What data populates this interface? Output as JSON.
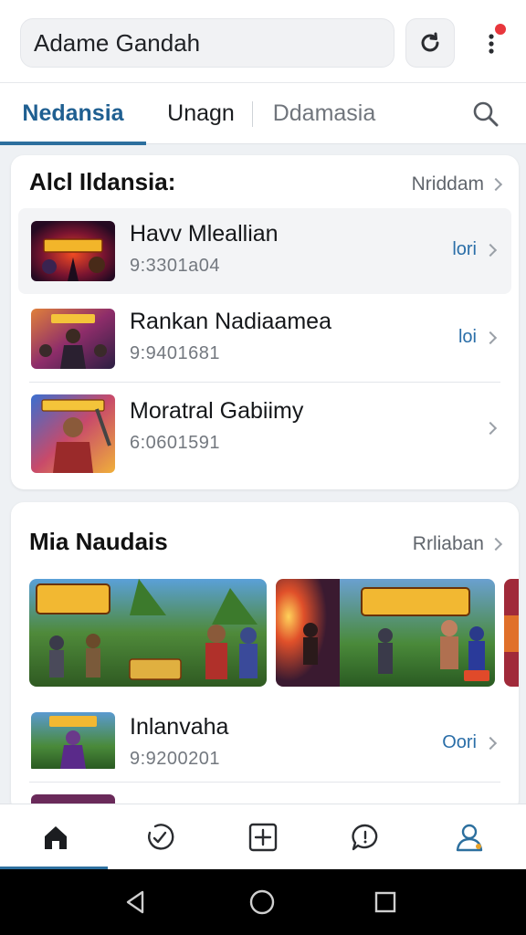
{
  "header": {
    "search_text": "Adame Gandah"
  },
  "tabs": [
    {
      "label": "Nedansia"
    },
    {
      "label": "Unagn"
    },
    {
      "label": "Ddamasia"
    }
  ],
  "section1": {
    "title": "Alcl Ildansia:",
    "link": "Nriddam",
    "items": [
      {
        "title": "Havv Mleallian",
        "subtitle": "9:3301a04",
        "action": "lori"
      },
      {
        "title": "Rankan Nadiaamea",
        "subtitle": "9:9401681",
        "action": "loi"
      },
      {
        "title": "Moratral Gabiimy",
        "subtitle": "6:0601591",
        "action": ""
      }
    ]
  },
  "section2": {
    "title": "Mia Naudais",
    "link": "Rrliaban",
    "items": [
      {
        "title": "Inlanvaha",
        "subtitle": "9:9200201",
        "action": "Oori"
      }
    ]
  },
  "colors": {
    "accent": "#2c6f9e",
    "active_tab": "#1f5f91",
    "notification": "#e8363c"
  },
  "icons": {
    "refresh": "refresh-icon",
    "more": "more-vertical-icon",
    "search": "search-icon",
    "nav": [
      "home-icon",
      "clock-check-icon",
      "plus-square-icon",
      "chat-bubble-icon",
      "user-icon"
    ],
    "system": [
      "back-icon",
      "home-circle-icon",
      "recents-icon"
    ]
  }
}
